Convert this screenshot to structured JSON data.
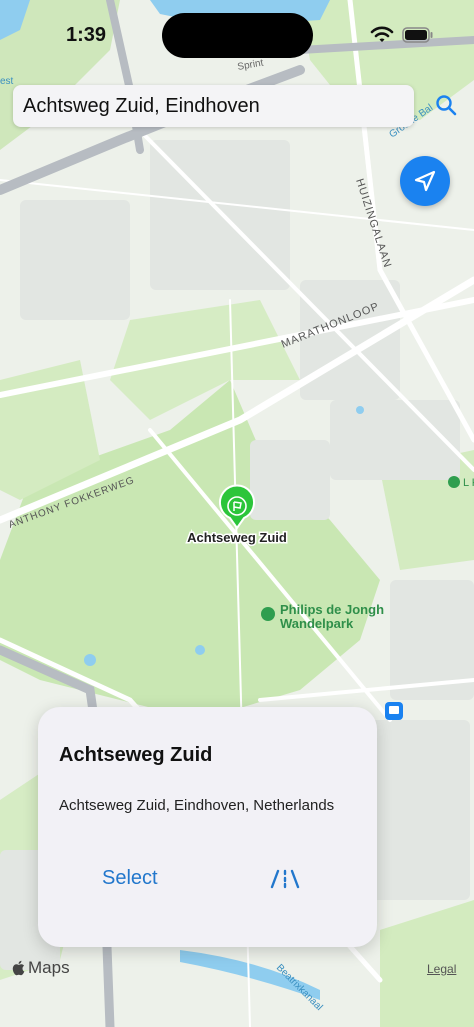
{
  "status_bar": {
    "time": "1:39"
  },
  "search": {
    "query": "Achtsweg Zuid, Eindhoven"
  },
  "map_labels": {
    "pin": "Achtseweg Zuid",
    "park_line1": "Philips de Jongh",
    "park_line2": "Wandelpark",
    "street_huizingalaan": "HUIZINGALAAN",
    "street_marathonloop": "MARATHONLOOP",
    "street_fokkerweg": "ANTHONY FOKKERWEG",
    "street_beatrixkanaal": "Beatrixkanaal",
    "street_groene": "Groene Bal",
    "street_sprint": "Sprint",
    "edge_west": "est",
    "edge_east": "L K"
  },
  "card": {
    "title": "Achtseweg Zuid",
    "address": "Achtseweg Zuid, Eindhoven, Netherlands",
    "select_label": "Select"
  },
  "footer": {
    "maps_label": "Maps",
    "legal_label": "Legal"
  },
  "colors": {
    "accent": "#1a82f0",
    "pin": "#2cc53a",
    "park": "#c8e6b0",
    "water": "#7cc3e8"
  },
  "icons": [
    "wifi-icon",
    "battery-icon",
    "search-icon",
    "location-arrow-icon",
    "flag-pin-icon",
    "directions-icon",
    "apple-icon",
    "park-icon",
    "bus-icon"
  ]
}
